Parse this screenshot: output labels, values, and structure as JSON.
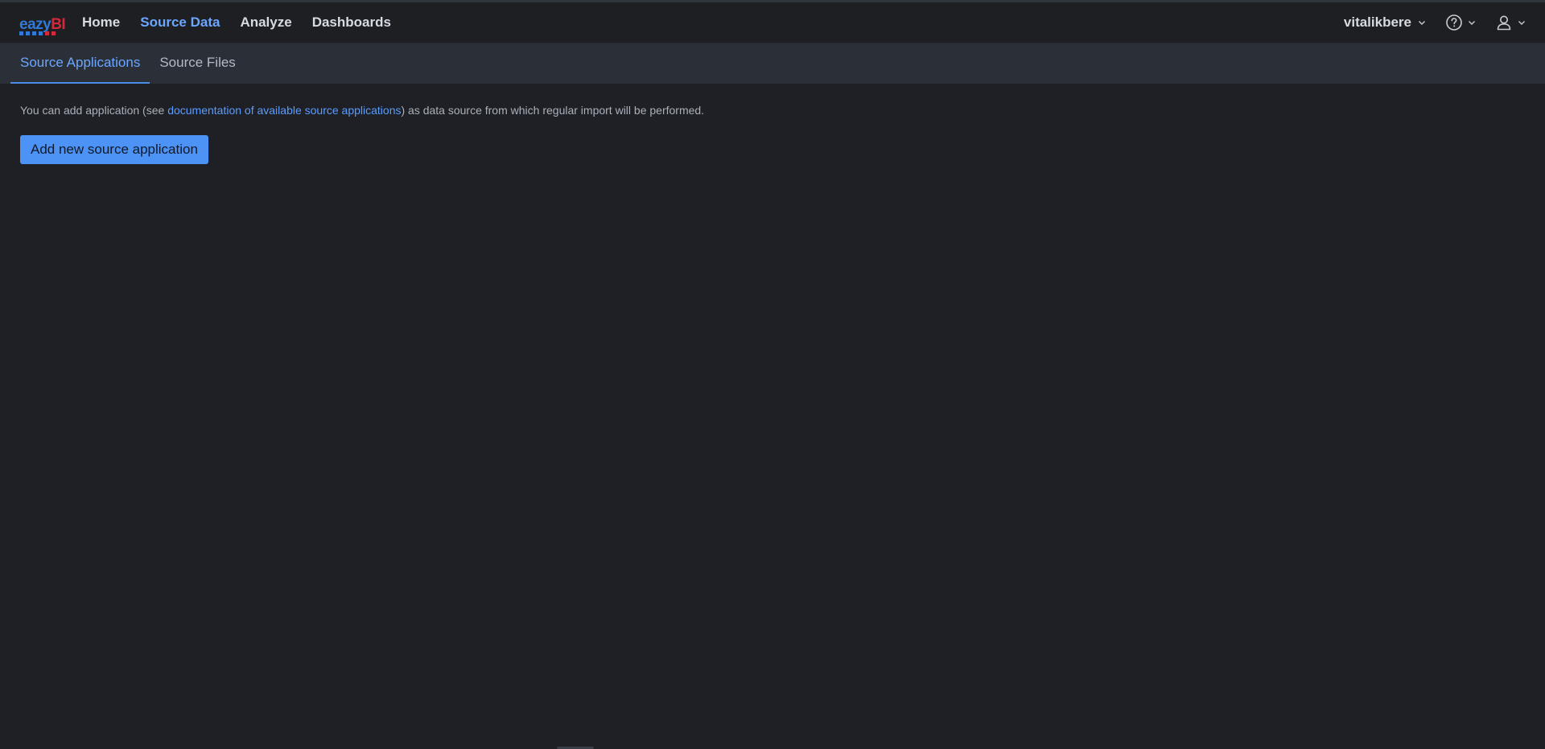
{
  "app": {
    "logo": {
      "part1": "eazy",
      "part2": "BI"
    }
  },
  "nav": {
    "items": [
      {
        "label": "Home"
      },
      {
        "label": "Source Data"
      },
      {
        "label": "Analyze"
      },
      {
        "label": "Dashboards"
      }
    ],
    "user": "vitalikbere",
    "help_icon": "help-circle-icon",
    "account_icon": "user-icon"
  },
  "tabs": [
    {
      "label": "Source Applications"
    },
    {
      "label": "Source Files"
    }
  ],
  "content": {
    "intro_before": "You can add application (see ",
    "intro_link": "documentation of available source applications",
    "intro_after": ") as data source from which regular import will be performed.",
    "add_button": "Add new source application"
  },
  "colors": {
    "accent": "#6ba6ff",
    "button": "#4c93f5",
    "background": "#1e2025",
    "navbar": "#1d1f23",
    "subnav": "#2b3038"
  }
}
